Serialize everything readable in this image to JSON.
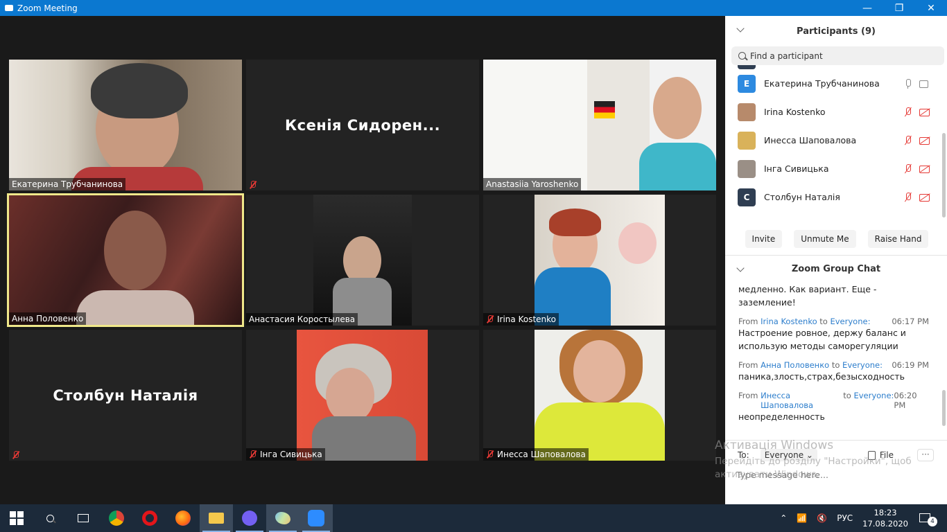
{
  "window": {
    "title": "Zoom Meeting",
    "minimize": "—",
    "restore": "❐",
    "close": "✕"
  },
  "tiles": [
    {
      "name": "Екатерина Трубчанинова",
      "muted": false,
      "video": true
    },
    {
      "name": "",
      "big_name": "Ксенія Сидорен...",
      "muted": true,
      "video": false
    },
    {
      "name": "Anastasiia Yaroshenko",
      "muted": false,
      "video": true
    },
    {
      "name": "Анна Половенко",
      "muted": false,
      "video": true,
      "active": true
    },
    {
      "name": "Анастасия Коростылева",
      "muted": false,
      "video": true
    },
    {
      "name": "Irina Kostenko",
      "muted": true,
      "video": true
    },
    {
      "name": "",
      "big_name": "Столбун Наталія",
      "muted": true,
      "video": false
    },
    {
      "name": "Інга Сивицька",
      "muted": true,
      "video": true
    },
    {
      "name": "Инесса Шаповалова",
      "muted": true,
      "video": true
    }
  ],
  "participants_panel": {
    "title": "Participants (9)",
    "search_placeholder": "Find a participant",
    "items": [
      {
        "name": "Екатерина Трубчанинова",
        "initial": "E",
        "avatar_color": "#2d8ae0",
        "muted": false
      },
      {
        "name": "Irina Kostenko",
        "initial": "",
        "avatar_color": "#b78a6b",
        "muted": true
      },
      {
        "name": "Инесса Шаповалова",
        "initial": "",
        "avatar_color": "#d9b25a",
        "muted": true
      },
      {
        "name": "Інга Сивицька",
        "initial": "",
        "avatar_color": "#9a8f86",
        "muted": true
      },
      {
        "name": "Столбун Наталія",
        "initial": "C",
        "avatar_color": "#2f3e52",
        "muted": true
      }
    ],
    "buttons": {
      "invite": "Invite",
      "unmute": "Unmute Me",
      "raise_hand": "Raise Hand"
    }
  },
  "chat": {
    "title": "Zoom Group Chat",
    "partial_message": "медленно. Как вариант. Еще - заземление!",
    "messages": [
      {
        "from_label": "From",
        "sender": "Irina Kostenko",
        "to_label": "to",
        "recipient": "Everyone:",
        "time": "06:17 PM",
        "text": "Настроение ровное, держу баланс и использую методы саморегуляции"
      },
      {
        "from_label": "From",
        "sender": "Анна Половенко",
        "to_label": "to",
        "recipient": "Everyone:",
        "time": "06:19 PM",
        "text": "паника,злость,страх,безысходность"
      },
      {
        "from_label": "From",
        "sender": "Инесса Шаповалова",
        "to_label": "to",
        "recipient": "Everyone:",
        "time": "06:20 PM",
        "text": "неопределенность"
      }
    ],
    "to_label": "To:",
    "to_value": "Everyone ⌄",
    "file_label": "File",
    "more_label": "···",
    "input_placeholder": "Type message here..."
  },
  "watermark": {
    "line1": "Активація Windows",
    "line2": "Перейдіть до розділу \"Настройки\", щоб активувати Windows."
  },
  "taskbar": {
    "language": "РУС",
    "time": "18:23",
    "date": "17.08.2020",
    "notifications": "4"
  }
}
